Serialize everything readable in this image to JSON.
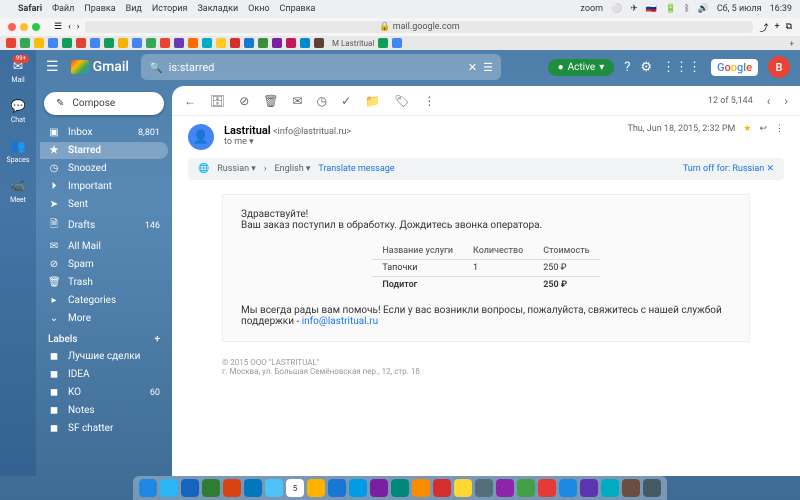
{
  "menubar": {
    "app": "Safari",
    "items": [
      "Файл",
      "Правка",
      "Вид",
      "История",
      "Закладки",
      "Окно",
      "Справка"
    ],
    "right": {
      "zoom": "zoom",
      "date": "Сб, 5 июля",
      "time": "16:39"
    }
  },
  "browser": {
    "url": "mail.google.com",
    "tab_label": "Lastritual"
  },
  "rail": {
    "mail": "Mail",
    "mail_badge": "99+",
    "chat": "Chat",
    "spaces": "Spaces",
    "meet": "Meet"
  },
  "header": {
    "brand": "Gmail",
    "search_value": "is:starred",
    "active": "Active"
  },
  "compose": "Compose",
  "folders": {
    "inbox": {
      "label": "Inbox",
      "count": "8,801"
    },
    "starred": {
      "label": "Starred"
    },
    "snoozed": {
      "label": "Snoozed"
    },
    "important": {
      "label": "Important"
    },
    "sent": {
      "label": "Sent"
    },
    "drafts": {
      "label": "Drafts",
      "count": "146"
    },
    "allmail": {
      "label": "All Mail"
    },
    "spam": {
      "label": "Spam"
    },
    "trash": {
      "label": "Trash"
    },
    "categories": {
      "label": "Categories"
    },
    "more": {
      "label": "More"
    }
  },
  "labels_header": "Labels",
  "labels": [
    {
      "label": "Лучшие сделки"
    },
    {
      "label": "IDEA"
    },
    {
      "label": "KO",
      "count": "60"
    },
    {
      "label": "Notes"
    },
    {
      "label": "SF chatter"
    }
  ],
  "toolbar": {
    "pager": "12 of 5,144"
  },
  "email": {
    "sender": "Lastritual",
    "sender_email": "<info@lastritual.ru>",
    "to": "to me",
    "date": "Thu, Jun 18, 2015, 2:32 PM",
    "translate": {
      "from": "Russian",
      "to": "English",
      "action": "Translate message",
      "off": "Turn off for: Russian"
    },
    "body": {
      "greeting": "Здравствуйте!",
      "line": "Ваш заказ поступил в обработку. Дождитесь звонка оператора.",
      "table": {
        "h1": "Название услуги",
        "h2": "Количество",
        "h3": "Стоимость",
        "item": "Тапочки",
        "qty": "1",
        "price": "250 ₽",
        "total_label": "Подитог",
        "total": "250 ₽"
      },
      "help": "Мы всегда рады вам помочь! Если у вас возникли вопросы, пожалуйста, свяжитесь с нашей службой поддержки - ",
      "support_email": "info@lastritual.ru",
      "footer1": "© 2015 ООО \"LASTRITUAL\"",
      "footer2": "г. Москва, ул. Большая Семёновская пер., 12, стр. 18"
    }
  },
  "avatar_letter": "B"
}
